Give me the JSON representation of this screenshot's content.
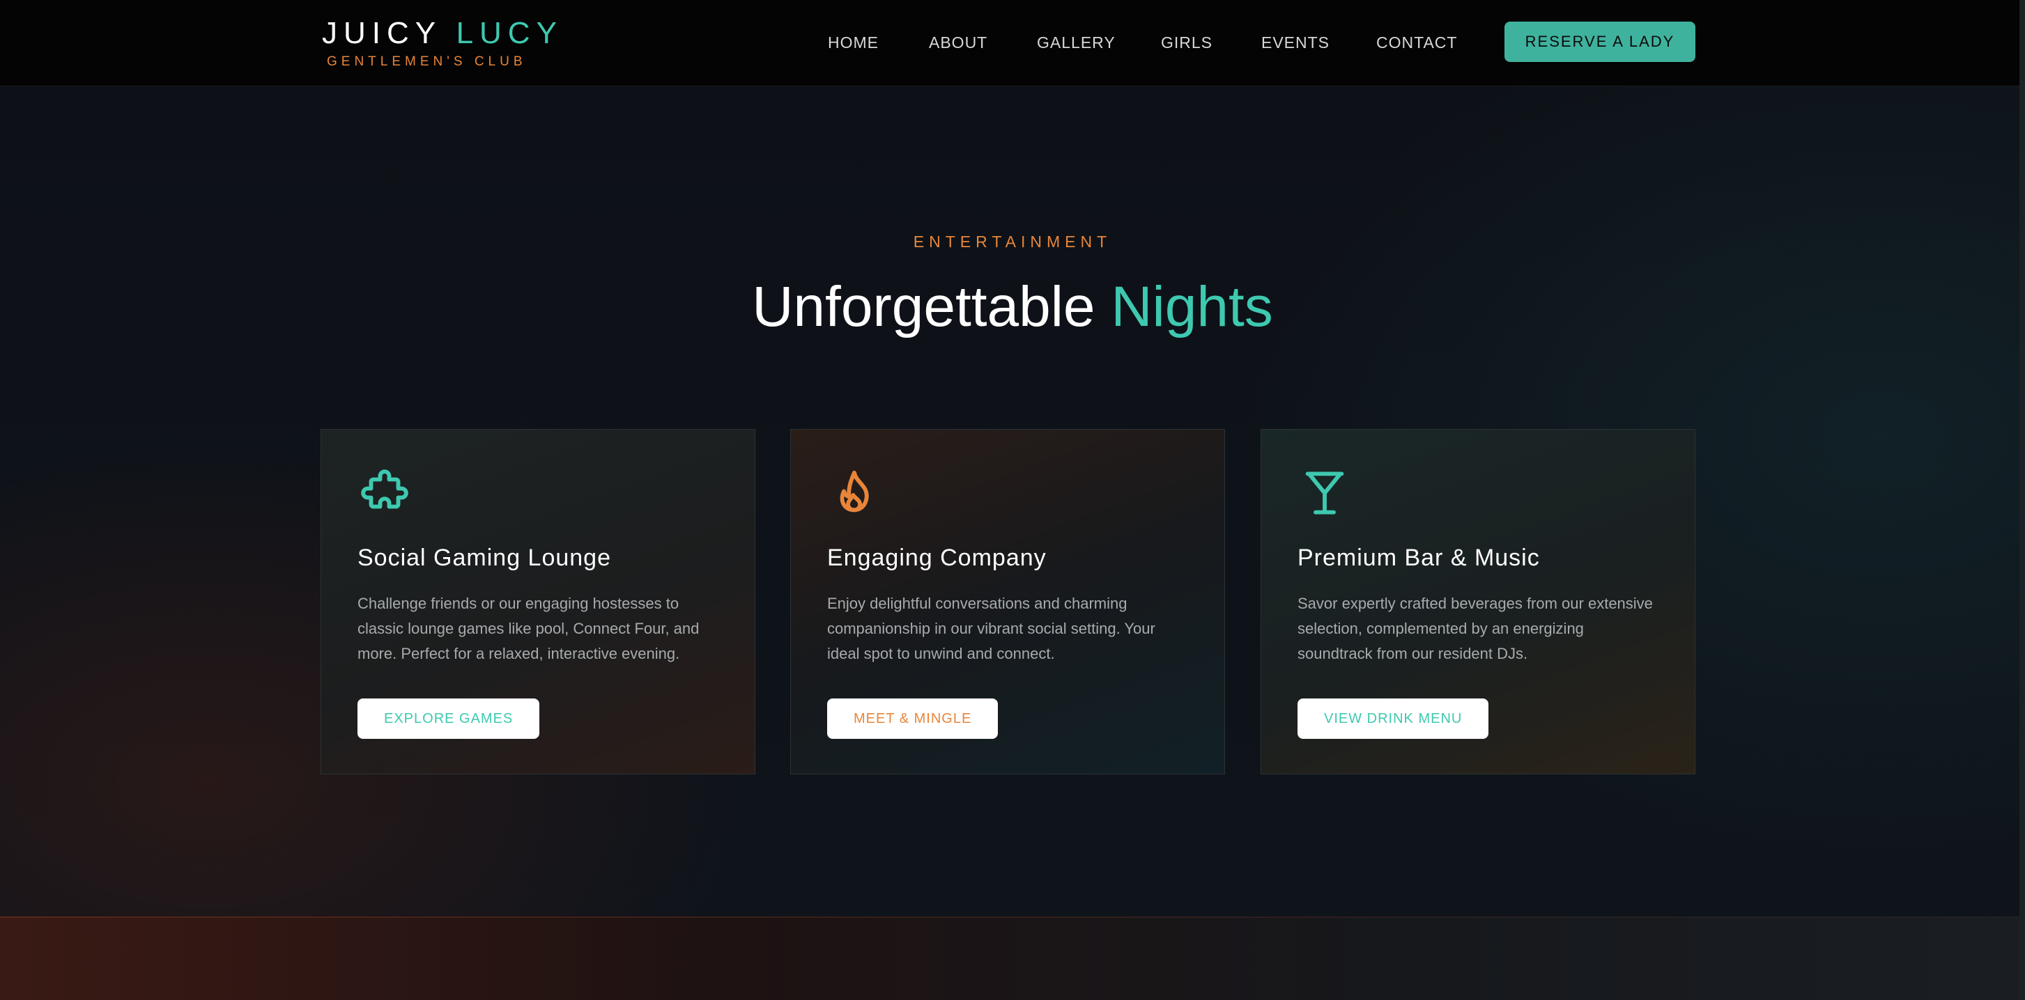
{
  "brand": {
    "name_part1": "JUICY",
    "name_part2": "LUCY",
    "tagline": "GENTLEMEN'S CLUB"
  },
  "nav": {
    "links": [
      "HOME",
      "ABOUT",
      "GALLERY",
      "GIRLS",
      "EVENTS",
      "CONTACT"
    ],
    "cta": "RESERVE A LADY"
  },
  "section": {
    "eyebrow": "ENTERTAINMENT",
    "headline_part1": "Unforgettable",
    "headline_part2": "Nights"
  },
  "cards": [
    {
      "icon": "puzzle-icon",
      "title": "Social Gaming Lounge",
      "description": "Challenge friends or our engaging hostesses to classic lounge games like pool, Connect Four, and more. Perfect for a relaxed, interactive evening.",
      "button": "EXPLORE GAMES"
    },
    {
      "icon": "flame-icon",
      "title": "Engaging Company",
      "description": "Enjoy delightful conversations and charming companionship in our vibrant social setting. Your ideal spot to unwind and connect.",
      "button": "MEET & MINGLE"
    },
    {
      "icon": "cocktail-icon",
      "title": "Premium Bar & Music",
      "description": "Savor expertly crafted beverages from our extensive selection, complemented by an energizing soundtrack from our resident DJs.",
      "button": "VIEW DRINK MENU"
    }
  ],
  "colors": {
    "teal": "#3ec9b0",
    "orange": "#e8853a",
    "cta_background": "#3fb29e",
    "nav_background": "#040404"
  }
}
